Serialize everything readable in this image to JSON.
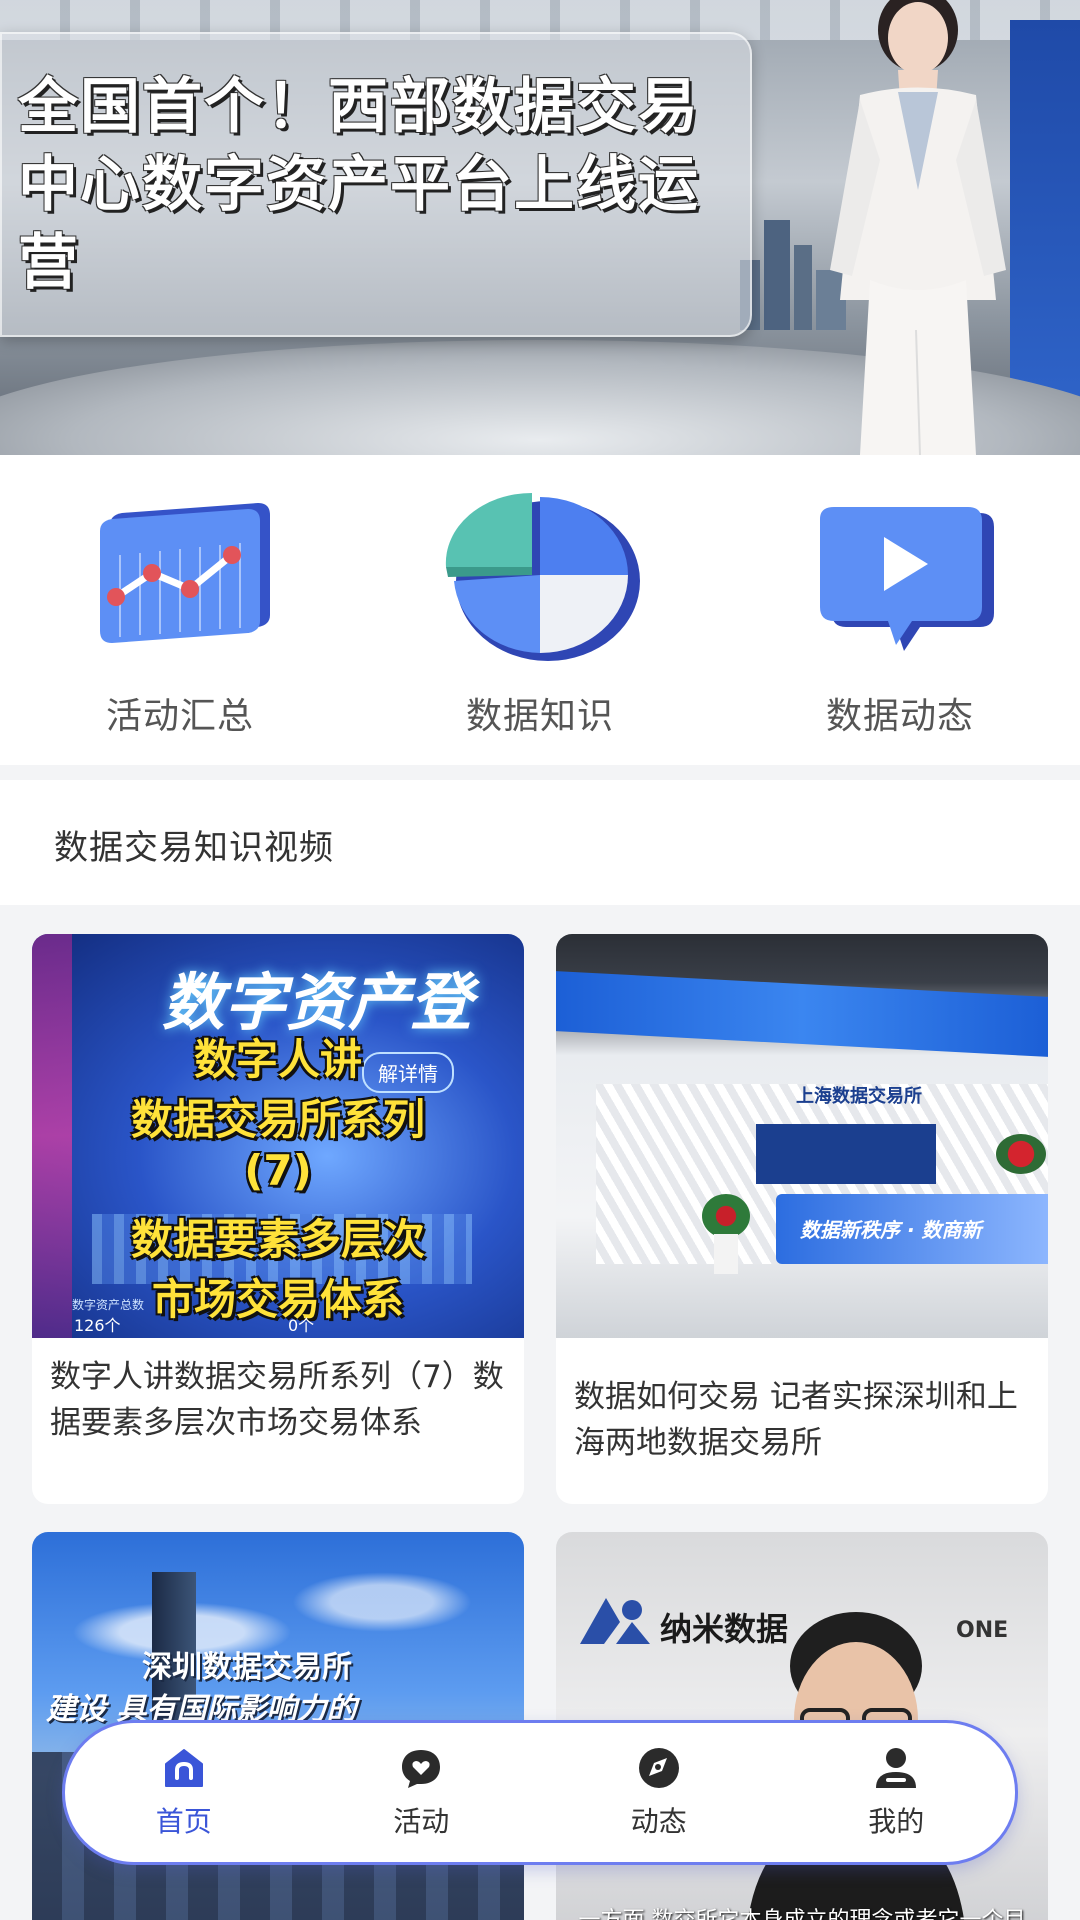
{
  "banner": {
    "headline": "全国首个！西部数据交易中心数字资产平台上线运营"
  },
  "categories": [
    {
      "label": "活动汇总",
      "icon": "line-chart-icon"
    },
    {
      "label": "数据知识",
      "icon": "pie-chart-icon"
    },
    {
      "label": "数据动态",
      "icon": "video-play-icon"
    }
  ],
  "section": {
    "title": "数据交易知识视频"
  },
  "videos": [
    {
      "thumb_banner": "数字资产登",
      "thumb_lines": [
        "数字人讲",
        "数据交易所系列",
        "(7)",
        "数据要素多层次",
        "市场交易体系"
      ],
      "thumb_tag": "解详情",
      "thumb_stat_label": "数字资产总数",
      "thumb_stat_value": "126个",
      "thumb_stat_value2": "0个",
      "caption": "数字人讲数据交易所系列（7）数据要素多层次市场交易体系"
    },
    {
      "thumb_sign": "数据新秩序 · 数商新",
      "thumb_logo_text": "上海数据交易所",
      "caption": "数据如何交易 记者实探深圳和上海两地数据交易所"
    },
    {
      "thumb_title": "深圳数据交易所",
      "thumb_sub": "建设 具有国际影响力的",
      "caption": ""
    },
    {
      "thumb_brand": "纳米数据",
      "thumb_brand2": "ONE",
      "thumb_subtitle": "一方面  数交所它本身成立的理念或者它一个目",
      "caption": ""
    }
  ],
  "nav": [
    {
      "label": "首页",
      "icon": "home-icon",
      "active": true
    },
    {
      "label": "活动",
      "icon": "heart-chat-icon",
      "active": false
    },
    {
      "label": "动态",
      "icon": "compass-icon",
      "active": false
    },
    {
      "label": "我的",
      "icon": "user-icon",
      "active": false
    }
  ],
  "colors": {
    "accent": "#3a55d8",
    "icon_blue": "#4d7ff0",
    "icon_teal": "#5fc9b8"
  }
}
